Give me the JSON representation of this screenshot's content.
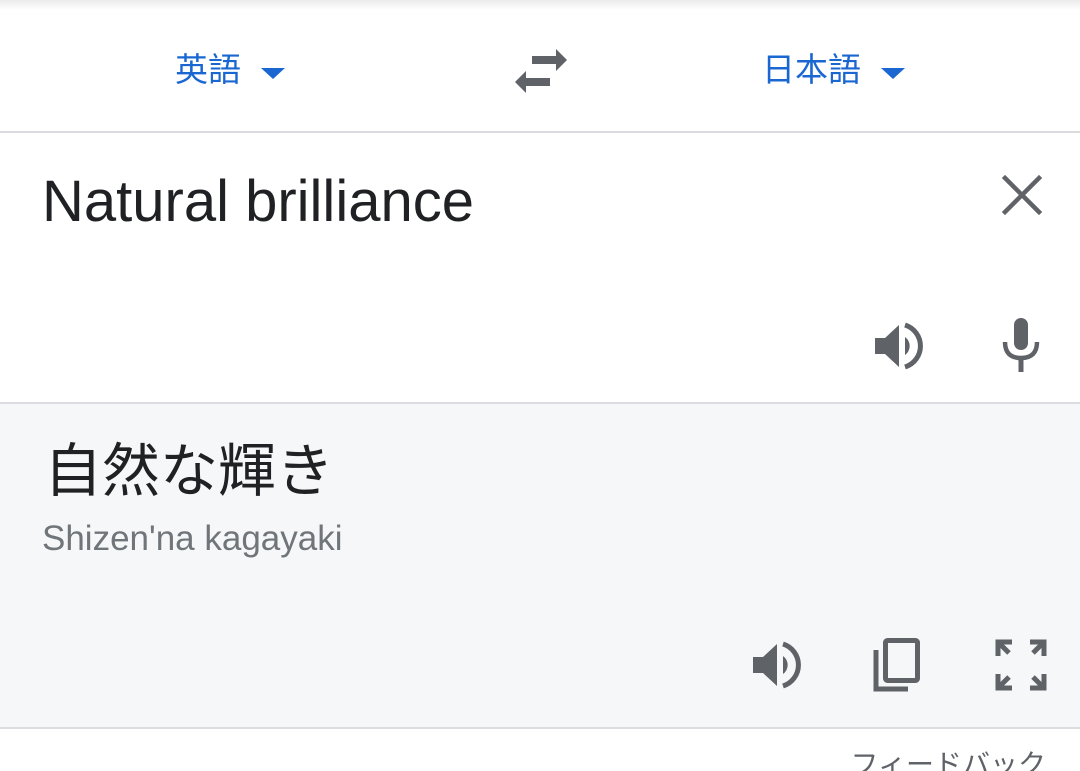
{
  "language_bar": {
    "source_language": "英語",
    "target_language": "日本語",
    "source_caret_icon": "caret-down-icon",
    "target_caret_icon": "caret-down-icon",
    "swap_icon": "swap-arrows-icon"
  },
  "source": {
    "text": "Natural brilliance",
    "icons": [
      "close-icon",
      "speaker-icon",
      "microphone-icon"
    ]
  },
  "result": {
    "translation": "自然な輝き",
    "romanization": "Shizen'na kagayaki",
    "icons": [
      "speaker-icon",
      "copy-icon",
      "fullscreen-icon"
    ]
  },
  "footer": {
    "feedback_label": "フィードバック"
  },
  "colors": {
    "accent": "#1a67d2",
    "icon": "#5f6368",
    "text": "#202124",
    "secondary_text": "#70757a",
    "result_background": "#f6f7f9",
    "divider": "#dadce0"
  }
}
